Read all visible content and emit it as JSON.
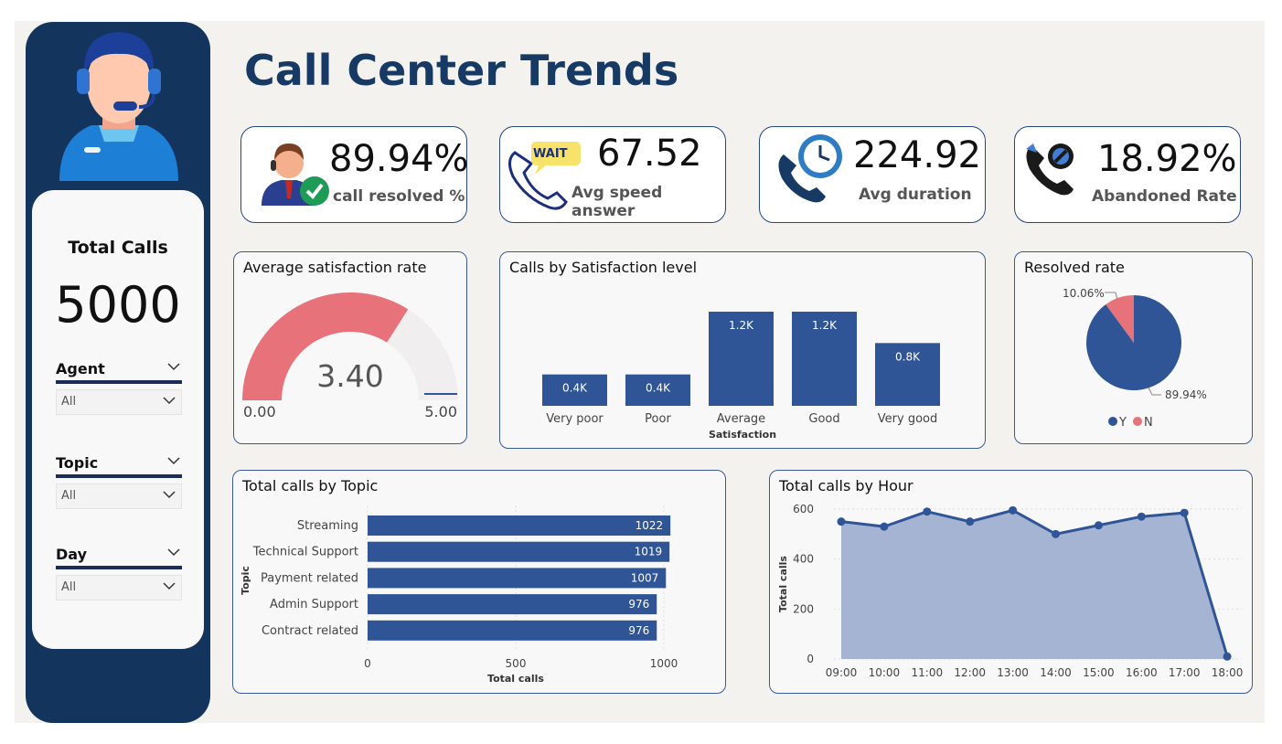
{
  "header": {
    "title": "Call Center Trends"
  },
  "sidebar": {
    "total_label": "Total Calls",
    "total_value": "5000",
    "slicers": [
      {
        "label": "Agent",
        "value": "All"
      },
      {
        "label": "Topic",
        "value": "All"
      },
      {
        "label": "Day",
        "value": "All"
      }
    ]
  },
  "kpis": [
    {
      "value": "89.94%",
      "label": "call resolved %",
      "icon": "agent-check-icon"
    },
    {
      "value": "67.52",
      "label": "Avg speed answer",
      "icon": "wait-phone-icon",
      "badge": "WAIT"
    },
    {
      "value": "224.92",
      "label": "Avg duration",
      "icon": "phone-clock-icon"
    },
    {
      "value": "18.92%",
      "label": "Abandoned Rate",
      "icon": "phone-blocked-icon"
    }
  ],
  "gauge": {
    "title": "Average satisfaction rate",
    "value_label": "3.40",
    "min_label": "0.00",
    "max_label": "5.00"
  },
  "satisfaction_chart": {
    "title": "Calls by Satisfaction level",
    "xlabel": "Satisfaction"
  },
  "resolved_chart": {
    "title": "Resolved rate"
  },
  "topic_chart": {
    "title": "Total calls by Topic",
    "xlabel": "Total calls",
    "ylabel": "Topic"
  },
  "hour_chart": {
    "title": "Total calls by Hour",
    "ylabel": "Total calls"
  },
  "colors": {
    "navy": "#13355d",
    "bar": "#2f5597",
    "area": "#a6b4d4",
    "pink": "#e8727a",
    "gauge_bg": "#f0eeee"
  },
  "chart_data": [
    {
      "type": "gauge",
      "title": "Average satisfaction rate",
      "value": 3.4,
      "min": 0,
      "max": 5,
      "labels": [
        "3.40",
        "0.00",
        "5.00"
      ]
    },
    {
      "type": "bar",
      "title": "Calls by Satisfaction level",
      "xlabel": "Satisfaction",
      "categories": [
        "Very poor",
        "Poor",
        "Average",
        "Good",
        "Very good"
      ],
      "values": [
        400,
        400,
        1200,
        1200,
        800
      ],
      "data_labels": [
        "0.4K",
        "0.4K",
        "1.2K",
        "1.2K",
        "0.8K"
      ],
      "ylim": [
        0,
        1200
      ]
    },
    {
      "type": "pie",
      "title": "Resolved rate",
      "categories": [
        "Y",
        "N"
      ],
      "values": [
        89.94,
        10.06
      ],
      "data_labels": [
        "89.94%",
        "10.06%"
      ],
      "legend": "bottom",
      "colors": [
        "#2f5597",
        "#e8727a"
      ]
    },
    {
      "type": "bar",
      "orientation": "horizontal",
      "title": "Total calls by Topic",
      "xlabel": "Total calls",
      "ylabel": "Topic",
      "categories": [
        "Streaming",
        "Technical Support",
        "Payment related",
        "Admin Support",
        "Contract related"
      ],
      "values": [
        1022,
        1019,
        1007,
        976,
        976
      ],
      "xlim": [
        0,
        1000
      ],
      "xticks": [
        "0",
        "500",
        "1000"
      ],
      "grid": true
    },
    {
      "type": "area",
      "title": "Total calls by Hour",
      "ylabel": "Total calls",
      "x": [
        "09:00",
        "10:00",
        "11:00",
        "12:00",
        "13:00",
        "14:00",
        "15:00",
        "16:00",
        "17:00",
        "18:00"
      ],
      "values": [
        550,
        530,
        590,
        550,
        595,
        500,
        535,
        570,
        585,
        10
      ],
      "ylim": [
        0,
        600
      ],
      "yticks": [
        "0",
        "200",
        "400",
        "600"
      ],
      "grid": true
    }
  ]
}
